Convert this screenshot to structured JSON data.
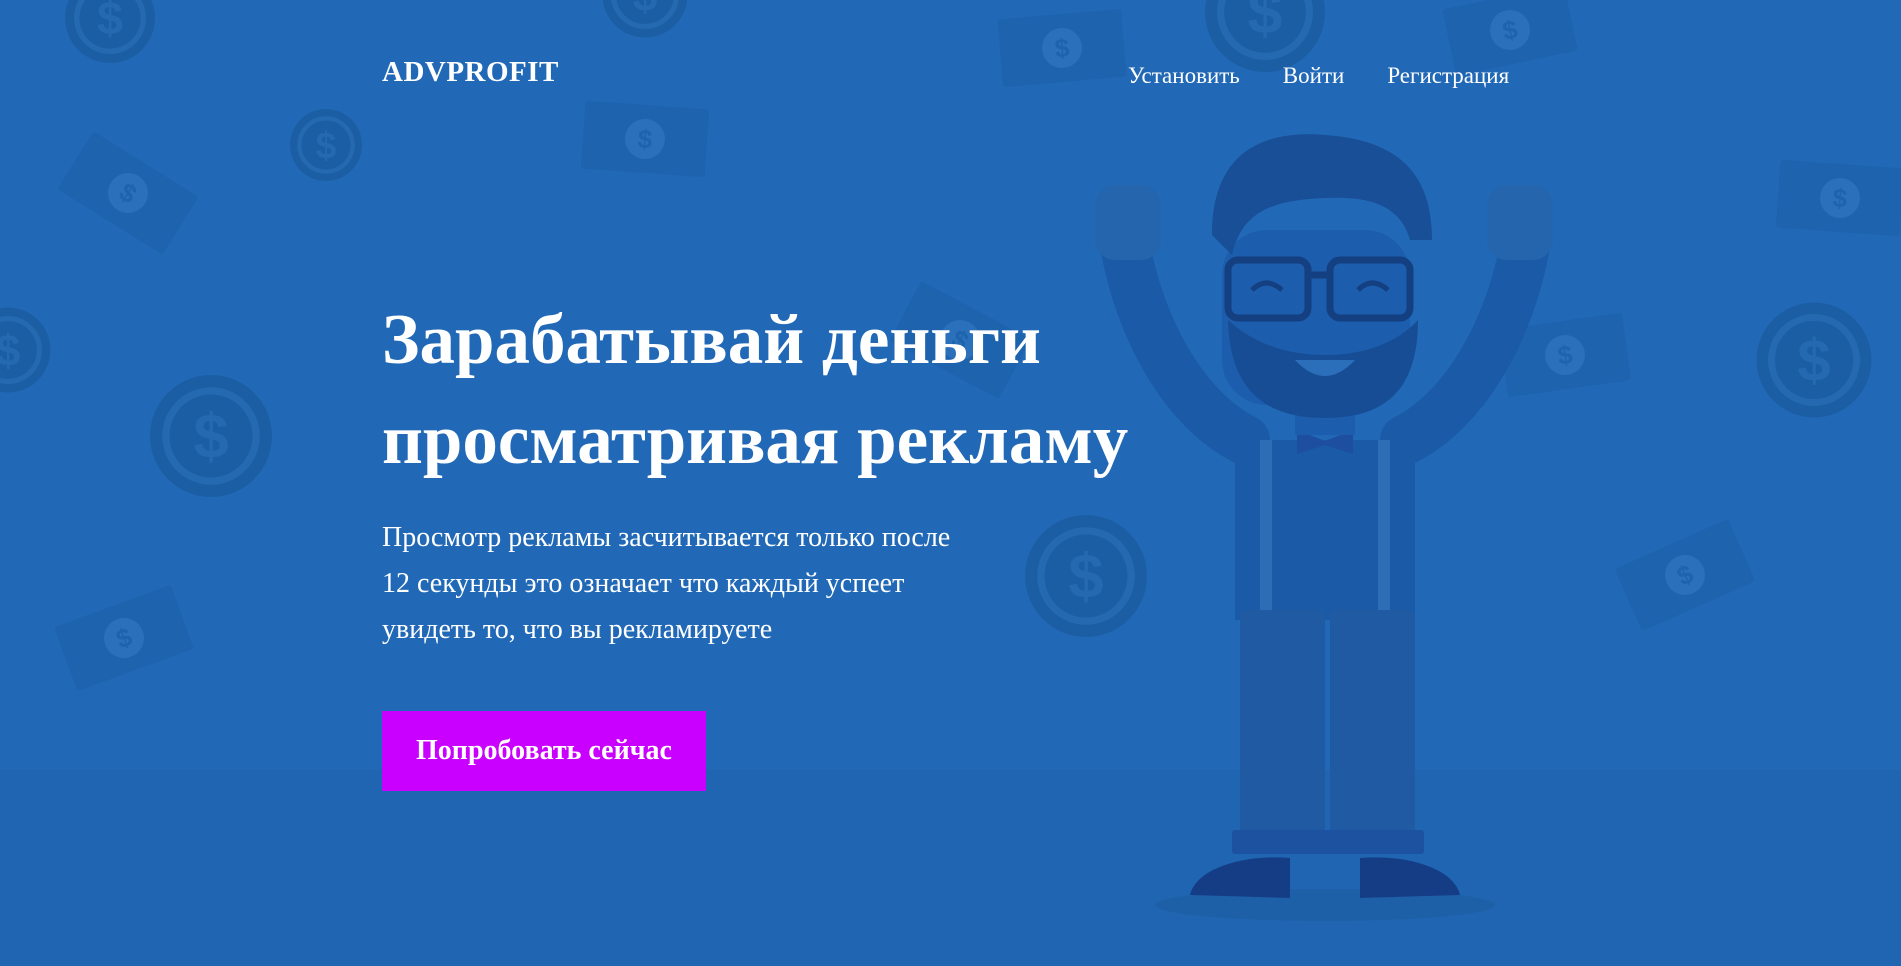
{
  "brand": {
    "logo_text": "ADVPROFIT"
  },
  "nav": {
    "items": [
      {
        "label": "Установить"
      },
      {
        "label": "Войти"
      },
      {
        "label": "Регистрация"
      }
    ]
  },
  "hero": {
    "headline_line1": "Зарабатывай деньги",
    "headline_line2": "просматривая рекламу",
    "description_line1": "Просмотр рекламы засчитывается только после",
    "description_line2": "12 секунды это означает что каждый успеет",
    "description_line3": "увидеть то, что вы рекламируете",
    "cta_label": "Попробовать сейчас"
  },
  "colors": {
    "background": "#2169b6",
    "accent": "#c900ff",
    "text": "#ffffff"
  },
  "icons": [
    "coin-icon",
    "banknote-icon",
    "mascot-illustration"
  ]
}
